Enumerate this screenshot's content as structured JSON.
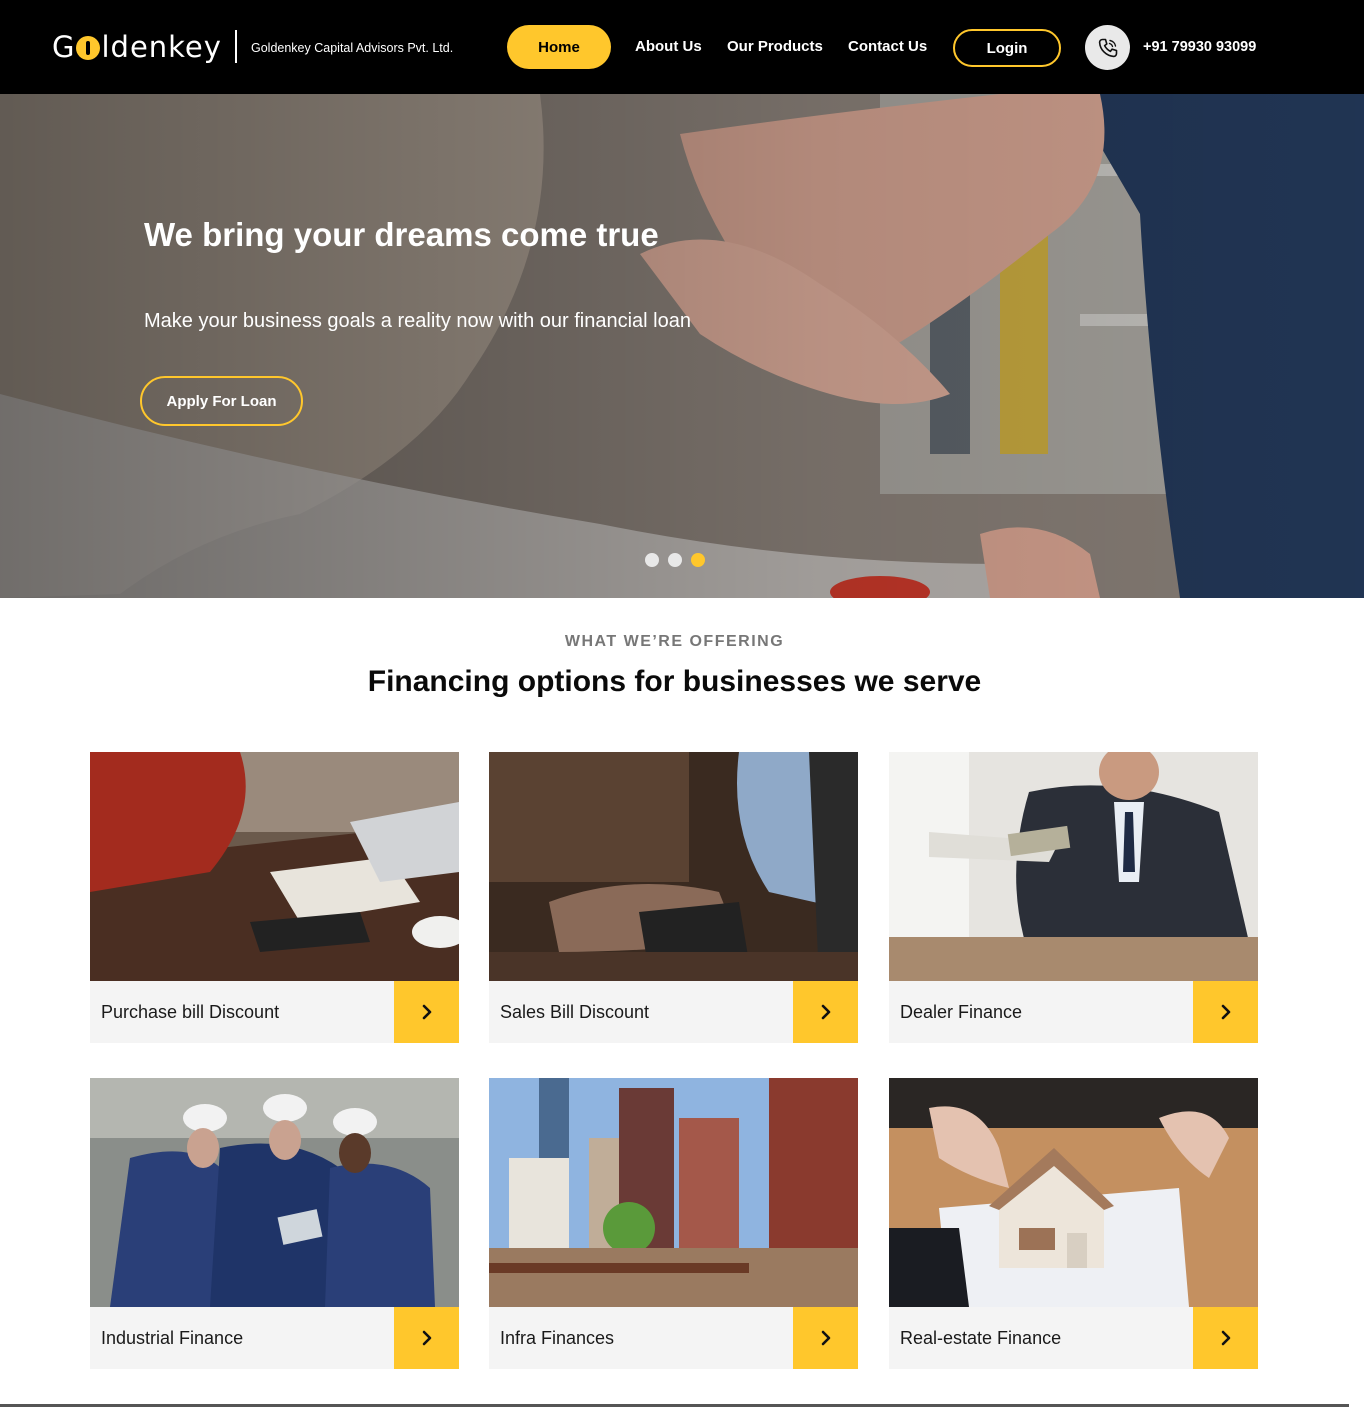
{
  "header": {
    "logo_text_prefix": "G",
    "logo_text_suffix": "ldenkey",
    "company_name": "Goldenkey Capital Advisors Pvt. Ltd.",
    "nav": {
      "home": "Home",
      "about": "About Us",
      "products": "Our Products",
      "contact": "Contact Us"
    },
    "login_label": "Login",
    "phone_icon": "phone-icon",
    "phone_number": "+91 79930 93099"
  },
  "hero": {
    "title": "We bring your dreams come true",
    "subtitle": "Make your business goals a reality now with our financial loan",
    "cta_label": "Apply For Loan",
    "slides_total": 3,
    "active_slide": 3
  },
  "offerings": {
    "eyebrow": "WHAT WE’RE OFFERING",
    "title": "Financing options for businesses we serve",
    "cards": [
      {
        "label": "Purchase bill Discount",
        "icon": "chevron-right-icon"
      },
      {
        "label": "Sales Bill Discount",
        "icon": "chevron-right-icon"
      },
      {
        "label": "Dealer Finance",
        "icon": "chevron-right-icon"
      },
      {
        "label": "Industrial Finance",
        "icon": "chevron-right-icon"
      },
      {
        "label": "Infra Finances",
        "icon": "chevron-right-icon"
      },
      {
        "label": "Real-estate Finance",
        "icon": "chevron-right-icon"
      }
    ]
  },
  "colors": {
    "accent": "#FFC72C",
    "header_bg": "#000000",
    "card_bg": "#F4F4F4"
  }
}
